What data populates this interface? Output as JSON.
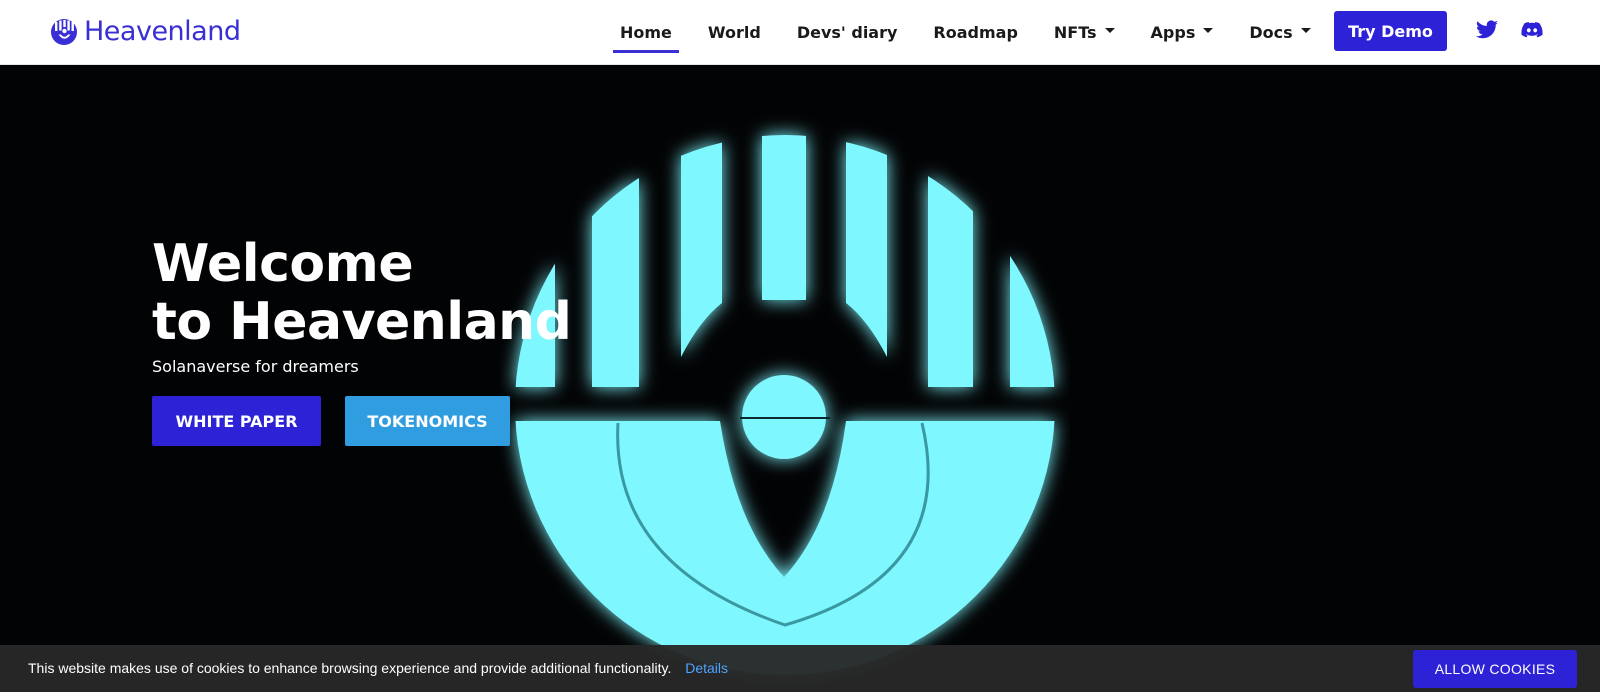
{
  "brand": {
    "name": "Heavenland",
    "logo_icon": "heavenland-logo-icon",
    "color": "#3a2fd4"
  },
  "nav": {
    "items": [
      {
        "label": "Home",
        "active": true,
        "dropdown": false
      },
      {
        "label": "World",
        "active": false,
        "dropdown": false
      },
      {
        "label": "Devs' diary",
        "active": false,
        "dropdown": false
      },
      {
        "label": "Roadmap",
        "active": false,
        "dropdown": false
      },
      {
        "label": "NFTs",
        "active": false,
        "dropdown": true
      },
      {
        "label": "Apps",
        "active": false,
        "dropdown": true
      },
      {
        "label": "Docs",
        "active": false,
        "dropdown": true
      }
    ],
    "try_demo": "Try Demo",
    "social_icons": [
      "twitter-icon",
      "discord-icon"
    ]
  },
  "hero": {
    "title_line1": "Welcome",
    "title_line2": "to Heavenland",
    "subtitle": "Solanaverse for dreamers",
    "buttons": {
      "white_paper": "WHITE PAPER",
      "tokenomics": "TOKENOMICS"
    },
    "emblem_color": "#7ff7ff"
  },
  "cookie": {
    "text": "This website makes use of cookies to enhance browsing experience and provide additional functionality.",
    "details": "Details",
    "allow": "ALLOW COOKIES"
  },
  "colors": {
    "accent": "#2e22d6",
    "secondary": "#2f9de0",
    "hero_bg": "#020304"
  }
}
